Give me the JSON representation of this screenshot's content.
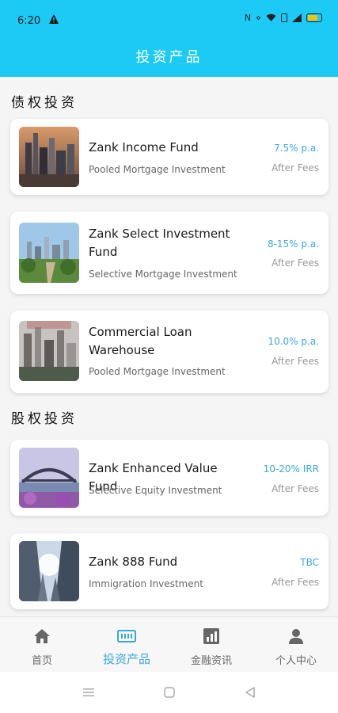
{
  "status_bar": {
    "time": "6:20",
    "icons": [
      "warning-icon",
      "nfc-icon",
      "vibrate-icon",
      "wifi-icon",
      "sim-icon",
      "signal-icon",
      "battery-icon"
    ]
  },
  "header": {
    "title": "投资产品"
  },
  "sections": [
    {
      "title": "债权投资",
      "products": [
        {
          "name": "Zank Income Fund",
          "desc": "Pooled Mortgage Investment",
          "rate": "7.5% p.a.",
          "fees": "After Fees",
          "image": "city-skyline-photo"
        },
        {
          "name": "Zank Select Investment Fund",
          "desc": "Selective Mortgage Investment",
          "rate": "8-15% p.a.",
          "fees": "After Fees",
          "image": "city-park-photo"
        },
        {
          "name": "Commercial Loan Warehouse",
          "desc": "Pooled Mortgage Investment",
          "rate": "10.0% p.a.",
          "fees": "After Fees",
          "image": "city-aerial-photo"
        }
      ]
    },
    {
      "title": "股权投资",
      "products": [
        {
          "name": "Zank Enhanced Value Fund",
          "desc": "Selective Equity Investment",
          "rate": "10-20% IRR",
          "fees": "After Fees",
          "image": "harbour-bridge-photo"
        },
        {
          "name": "Zank 888 Fund",
          "desc": "Immigration Investment",
          "rate": "TBC",
          "fees": "After Fees",
          "image": "skyscrapers-photo"
        }
      ]
    }
  ],
  "bottom_nav": [
    {
      "label": "首页",
      "icon": "home-icon",
      "active": false
    },
    {
      "label": "投资产品",
      "icon": "product-icon",
      "active": true
    },
    {
      "label": "金融资讯",
      "icon": "chart-icon",
      "active": false
    },
    {
      "label": "个人中心",
      "icon": "person-icon",
      "active": false
    }
  ],
  "colors": {
    "header_bg": "#1ccaf5",
    "accent": "#3aa8dc"
  }
}
